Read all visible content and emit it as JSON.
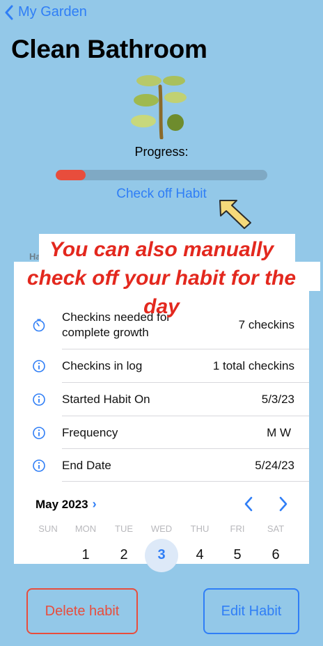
{
  "nav": {
    "back_label": "My Garden"
  },
  "habit": {
    "title": "Clean Bathroom"
  },
  "progress": {
    "label": "Progress:",
    "fraction": 0.14
  },
  "actions": {
    "check_off": "Check off Habit",
    "delete": "Delete habit",
    "edit": "Edit Habit"
  },
  "details": {
    "header": "Ha",
    "rows": [
      {
        "icon": "timer-icon",
        "label": "Checkins needed for complete growth",
        "value": "7 checkins"
      },
      {
        "icon": "info-icon",
        "label": "Checkins in log",
        "value": "1 total checkins"
      },
      {
        "icon": "info-icon",
        "label": "Started Habit On",
        "value": "5/3/23"
      },
      {
        "icon": "info-icon",
        "label": "Frequency",
        "value": "M W"
      },
      {
        "icon": "info-icon",
        "label": "End Date",
        "value": "5/24/23"
      }
    ]
  },
  "calendar": {
    "month": "May 2023",
    "weekdays": [
      "SUN",
      "MON",
      "TUE",
      "WED",
      "THU",
      "FRI",
      "SAT"
    ],
    "days": [
      "",
      "1",
      "2",
      "3",
      "4",
      "5",
      "6"
    ],
    "selected": "3"
  },
  "overlay": {
    "line1": "You can also manually",
    "line2": "check off your habit for the",
    "line3": "day"
  },
  "colors": {
    "background": "#93c8e8",
    "accent": "#2f7ef6",
    "danger": "#e84d3c",
    "caption": "#e3281e"
  }
}
